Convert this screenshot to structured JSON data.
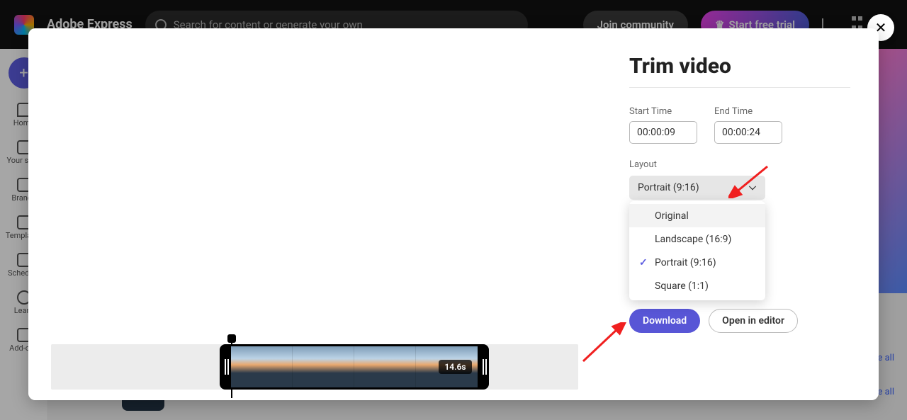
{
  "background": {
    "brand": "Adobe Express",
    "search_placeholder": "Search for content or generate your own",
    "join_label": "Join community",
    "trial_label": "Start free trial",
    "nav_items": [
      "Home",
      "Your stuff",
      "Brands",
      "Templates",
      "Schedule",
      "Learn",
      "Add-ons"
    ],
    "see_all": "See all"
  },
  "modal": {
    "title": "Trim video",
    "start_time_label": "Start Time",
    "end_time_label": "End Time",
    "start_time_value": "00:00:09",
    "end_time_value": "00:00:24",
    "layout_label": "Layout",
    "layout_selected": "Portrait (9:16)",
    "layout_options": [
      "Original",
      "Landscape (16:9)",
      "Portrait (9:16)",
      "Square (1:1)"
    ],
    "duration_badge": "14.6s",
    "download_label": "Download",
    "open_editor_label": "Open in editor"
  }
}
